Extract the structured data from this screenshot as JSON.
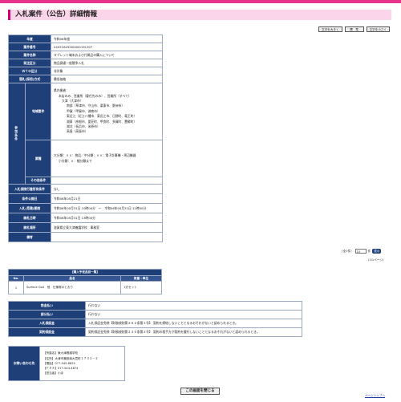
{
  "page_title": "入札案件（公告）詳細情報",
  "size_buttons": [
    "文字を大きく",
    "標　準",
    "文字を小さく"
  ],
  "detail": {
    "year_label": "年度",
    "year_value": "令和06年度",
    "case_no_label": "案件番号",
    "case_no_value": "24051625000000191307",
    "case_name_label": "案件名称",
    "case_name_value": "タブレット端末および付属品の購入について",
    "category_label": "発注区分",
    "category_value": "物品調達一般競争入札",
    "wto_label": "ＷＴＯ区分",
    "wto_value": "非対象",
    "method_label": "落札(採用)方式",
    "method_value": "最低価格",
    "qualification_group_label": "参加条件",
    "region_label": "地域要件",
    "region_lines": [
      "県内業者：",
      "本店のみ、営業所（委任先のみ）、営業所（すべて）",
      "大津（大津市）",
      "南部（草津市、守山市、栗東市、野洲市）",
      "甲賀（甲賀市、湖南市）",
      "東近江（近江八幡市、東近江市、日野町、竜王町）",
      "湖東（彦根市、愛荘町、甲良町、多賀町、豊郷町）",
      "湖北（長浜市、米原市）",
      "高島（高島市）"
    ],
    "industry_label": "業種",
    "industry_lines": [
      "大分類：ｘｘ：物品／中分類：ｘｘ：電子計算機・周辺機器",
      "小分類：ｘ：細分類まで"
    ],
    "other_label": "その他条件",
    "other_value": "",
    "loss_label": "入札保険行書所有条件",
    "loss_value": "なし",
    "announce_label": "条件公開日",
    "announce_value": "令和06年05月21日",
    "period_label": "入札(見積)期間",
    "period_value": "令和06年05月31日 10時00分　～　令和06年05月31日 12時00分",
    "open_label": "開札日時",
    "open_value": "令和06年05月31日 13時00分",
    "place_label": "開札場所",
    "place_value": "滋賀県立東大津養護学校　事務室",
    "note_label": "備考",
    "note_value": ""
  },
  "pager": {
    "total": "（全1件）",
    "per_page": "10",
    "per_page_suffix": "件",
    "go_label": "表示",
    "page_count": "(1/1ページ)"
  },
  "items": {
    "title": "【購入予定品目一覧】",
    "headers": {
      "no": "No.",
      "name": "品名",
      "qty": "数量・単位"
    },
    "rows": [
      {
        "no": "1",
        "name": "Surface Go4　他　仕様書のとおり",
        "qty": "1式セット"
      }
    ]
  },
  "payment": [
    {
      "label": "前金払い",
      "value": "行わない"
    },
    {
      "label": "部分払い",
      "value": "行わない"
    },
    {
      "label": "入札保証金",
      "value": "入札保証金免除【財務規則第２０２条第３号】 契約を締結しないこととなるおそれがないと認められるとき。"
    },
    {
      "label": "契約保証金",
      "value": "契約保証金免除【財務規則第２３０条第３号】 契約の相手方が契約を履行しないこととなるおそれがないと認められるとき。"
    }
  ],
  "contact": {
    "label": "お問い合わせ先",
    "lines": [
      "【所属名】東大津養護学校",
      "【住所】大津市瀬田南大萱町１７３２－２",
      "【電話】077-545-8825",
      "【ＦＡＸ】077-543-4874",
      "【担当者】小寺"
    ]
  },
  "close_button": "この画面を閉じる",
  "page_top": "ページトップへ"
}
